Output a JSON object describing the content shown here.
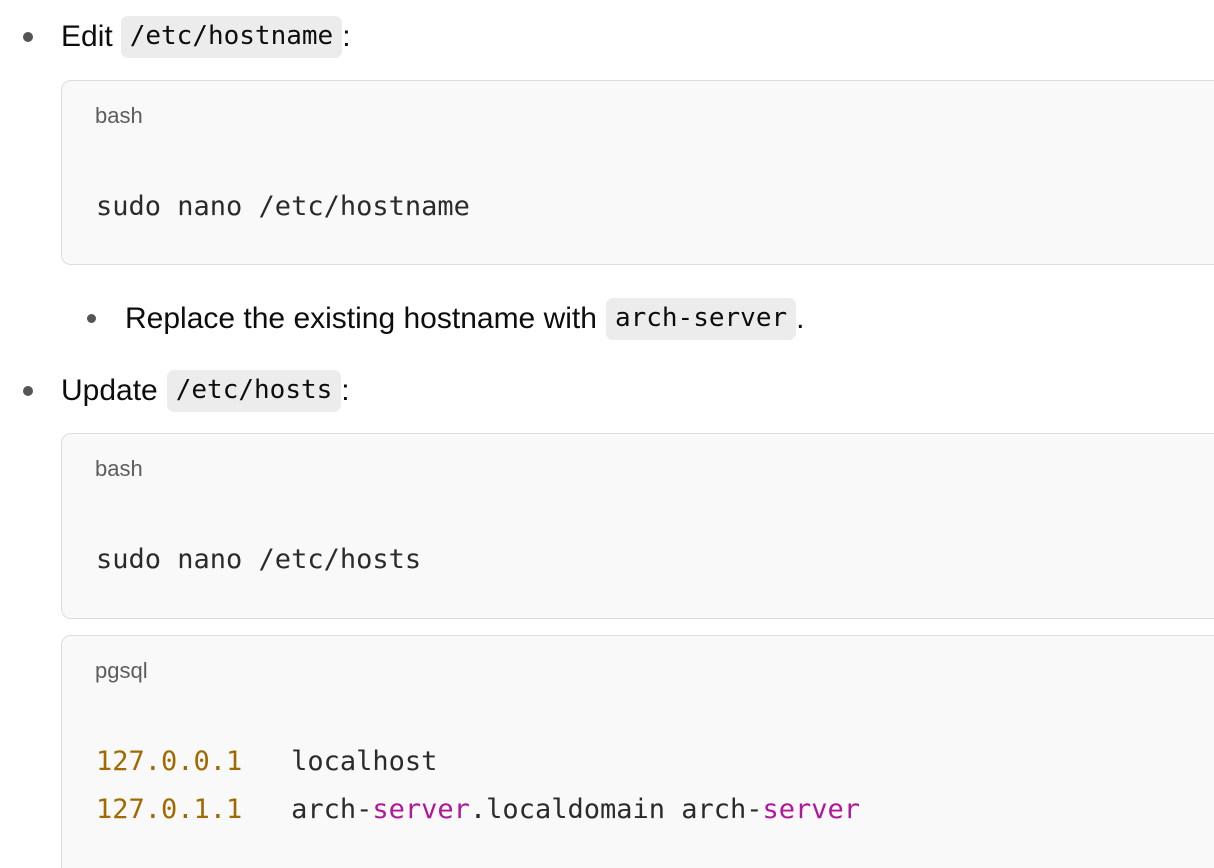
{
  "items": [
    {
      "text": "Edit",
      "code": "/etc/hostname",
      "suffix": ":"
    },
    {
      "text": "Replace the existing hostname with",
      "code": "arch-server",
      "suffix": "."
    },
    {
      "text": "Update",
      "code": "/etc/hosts",
      "suffix": ":"
    }
  ],
  "code_blocks": [
    {
      "language": "bash",
      "lines": [
        "sudo nano /etc/hostname"
      ]
    },
    {
      "language": "bash",
      "lines": [
        "sudo nano /etc/hosts"
      ]
    },
    {
      "language": "pgsql",
      "lines": [
        {
          "ip": "127.0.0.1",
          "gap": "   ",
          "host": "localhost"
        },
        {
          "ip": "127.0.1.1",
          "gap": "   ",
          "host_parts": [
            "arch-",
            "server",
            ".localdomain arch-",
            "server"
          ]
        }
      ]
    }
  ],
  "colors": {
    "number": "#a06a00",
    "keyword": "#b0179a",
    "code_bg": "#f9f9f9",
    "inline_code_bg": "#ececec"
  }
}
